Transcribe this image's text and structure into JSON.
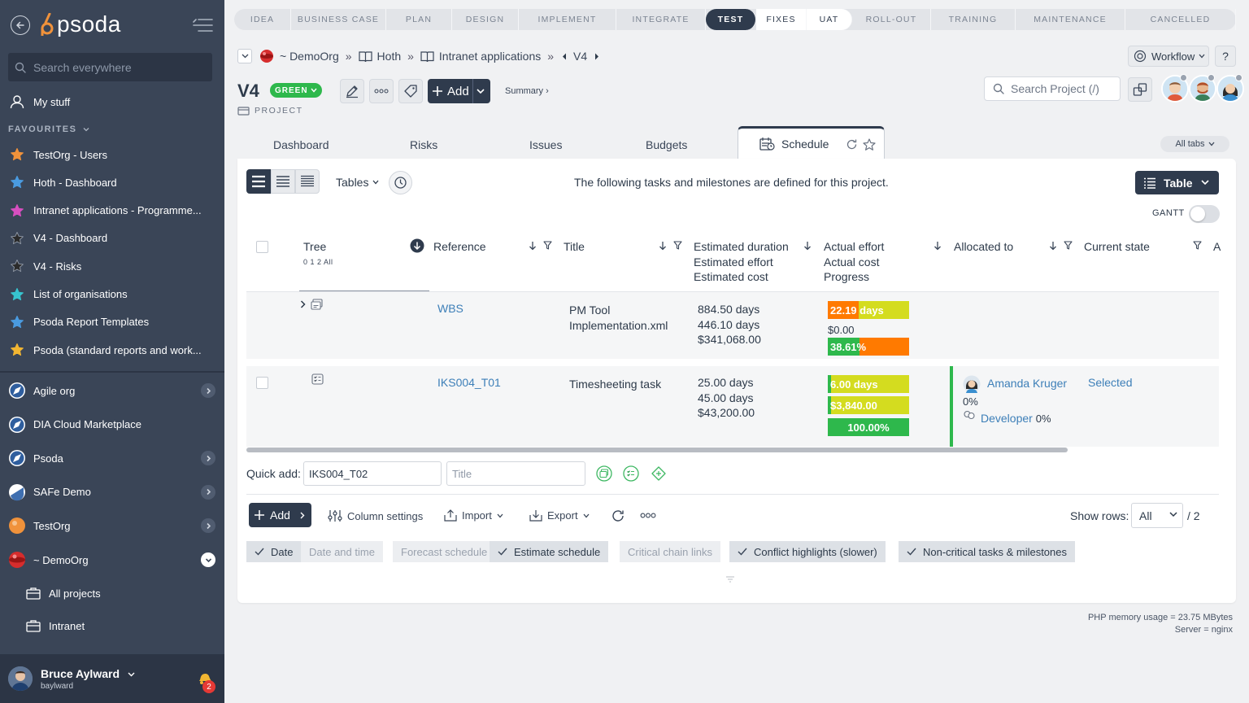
{
  "sidebar": {
    "logo": "psoda",
    "search_placeholder": "Search everywhere",
    "my_stuff": "My stuff",
    "favourites_title": "FAVOURITES",
    "favourites": [
      {
        "label": "TestOrg - Users",
        "color": "#f0923b"
      },
      {
        "label": "Hoth - Dashboard",
        "color": "#4a9be0"
      },
      {
        "label": "Intranet applications - Programme...",
        "color": "#d74fc0"
      },
      {
        "label": "V4 - Dashboard",
        "color": "#2b2b2b"
      },
      {
        "label": "V4 - Risks",
        "color": "#2b2b2b"
      },
      {
        "label": "List of organisations",
        "color": "#37c4cf"
      },
      {
        "label": "Psoda Report Templates",
        "color": "#4a9be0"
      },
      {
        "label": "Psoda (standard reports and work...",
        "color": "#f2b632"
      }
    ],
    "orgs": [
      {
        "label": "Agile org",
        "icon": "compass-icon",
        "chevron": "right"
      },
      {
        "label": "DIA Cloud Marketplace",
        "icon": "compass-icon",
        "chevron": ""
      },
      {
        "label": "Psoda",
        "icon": "compass-icon",
        "chevron": "right"
      },
      {
        "label": "SAFe Demo",
        "icon": "safe-icon",
        "chevron": "right"
      },
      {
        "label": "TestOrg",
        "icon": "orange-ball-icon",
        "chevron": "right"
      },
      {
        "label": "~ DemoOrg",
        "icon": "red-ball-icon",
        "chevron": "down"
      }
    ],
    "sub_items": [
      {
        "label": "All projects"
      },
      {
        "label": "Intranet"
      }
    ],
    "user": {
      "name": "Bruce Aylward",
      "username": "baylward",
      "notifications": "2"
    }
  },
  "phases": [
    {
      "label": "IDEA",
      "state": "normal"
    },
    {
      "label": "BUSINESS CASE",
      "state": "normal"
    },
    {
      "label": "PLAN",
      "state": "normal"
    },
    {
      "label": "DESIGN",
      "state": "normal"
    },
    {
      "label": "IMPLEMENT",
      "state": "normal"
    },
    {
      "label": "INTEGRATE",
      "state": "normal"
    },
    {
      "label": "TEST",
      "state": "active"
    },
    {
      "label": "FIXES",
      "state": "done"
    },
    {
      "label": "UAT",
      "state": "done"
    },
    {
      "label": "ROLL-OUT",
      "state": "normal"
    },
    {
      "label": "TRAINING",
      "state": "normal"
    },
    {
      "label": "MAINTENANCE",
      "state": "normal"
    },
    {
      "label": "CANCELLED",
      "state": "normal"
    }
  ],
  "breadcrumb": {
    "org": "~ DemoOrg",
    "sep": "»",
    "portfolio": "Hoth",
    "programme": "Intranet applications",
    "project": "V4"
  },
  "header": {
    "workflow": "Workflow",
    "help": "?",
    "title": "V4",
    "status": "GREEN",
    "type": "PROJECT",
    "add": "Add",
    "summary": "Summary ›",
    "search_placeholder": "Search Project (/)"
  },
  "tabs": {
    "items": [
      "Dashboard",
      "Risks",
      "Issues",
      "Budgets"
    ],
    "active": "Schedule",
    "all_tabs": "All tabs"
  },
  "schedule": {
    "tables_label": "Tables",
    "intro": "The following tasks and milestones are defined for this project.",
    "view_button": "Table",
    "gantt_label": "GANTT",
    "tree_levels": "0 1 2 All",
    "columns": {
      "tree": "Tree",
      "reference": "Reference",
      "title": "Title",
      "estimates": [
        "Estimated duration",
        "Estimated effort",
        "Estimated cost"
      ],
      "actuals": [
        "Actual effort",
        "Actual cost",
        "Progress"
      ],
      "allocated": "Allocated to",
      "state": "Current state",
      "next": "A"
    },
    "rows": [
      {
        "reference": "WBS",
        "title": [
          "PM Tool",
          "Implementation.xml"
        ],
        "estimates": [
          "884.50 days",
          "446.10 days",
          "$341,068.00"
        ],
        "actual_effort": "22.19 days",
        "actual_cost": "$0.00",
        "progress": "38.61%",
        "progress_fraction": 0.3861
      },
      {
        "reference": "IKS004_T01",
        "title": [
          "Timesheeting task"
        ],
        "estimates": [
          "25.00 days",
          "45.00 days",
          "$43,200.00"
        ],
        "actual_effort": "6.00 days",
        "actual_cost": "$3,840.00",
        "progress": "100.00%",
        "progress_fraction": 1.0,
        "allocated_name": "Amanda Kruger",
        "allocated_pct": "0%",
        "role": "Developer",
        "role_pct": "0%",
        "state": "Selected"
      }
    ],
    "quick_add_label": "Quick add:",
    "quick_add_ref": "IKS004_T02",
    "quick_add_title_placeholder": "Title",
    "add_label": "Add",
    "actions": {
      "column_settings": "Column settings",
      "import": "Import",
      "export": "Export"
    },
    "show_rows_label": "Show rows:",
    "show_rows_value": "All",
    "show_rows_total": "/ 2",
    "toggles": [
      {
        "label": "Date",
        "on": true
      },
      {
        "label": "Date and time",
        "on": false
      },
      {
        "label": "Forecast schedule",
        "on": false
      },
      {
        "label": "Estimate schedule",
        "on": true
      },
      {
        "label": "Critical chain links",
        "on": false
      },
      {
        "label": "Conflict highlights (slower)",
        "on": true
      },
      {
        "label": "Non-critical tasks & milestones",
        "on": true
      }
    ]
  },
  "footer": {
    "memory": "PHP memory usage = 23.75 MBytes",
    "server": "Server = nginx"
  },
  "colors": {
    "accent": "#2f3b4d",
    "green": "#2eb84c",
    "yellow": "#d4dc1f",
    "orange": "#ff7a00",
    "link": "#3d7fb8"
  }
}
